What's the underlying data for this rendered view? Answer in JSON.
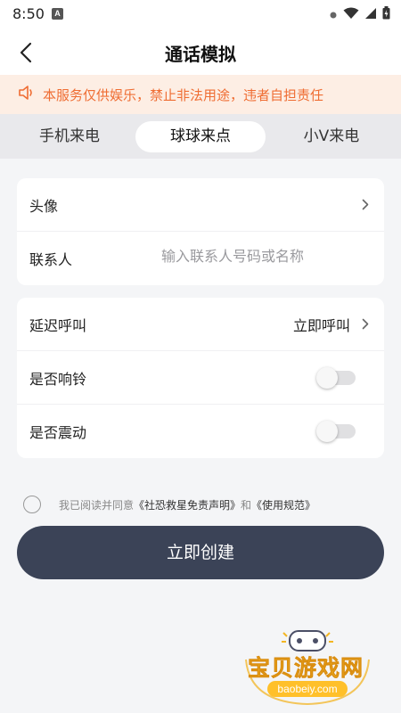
{
  "status_bar": {
    "time": "8:50",
    "indicator": "A",
    "icons": [
      "settings-dot-icon",
      "wifi-icon",
      "signal-icon",
      "battery-icon"
    ]
  },
  "nav": {
    "title": "通话模拟"
  },
  "notice": {
    "text": "本服务仅供娱乐，禁止非法用途，违者自担责任",
    "color": "#ef6d33"
  },
  "tabs": [
    {
      "label": "手机来电",
      "active": false
    },
    {
      "label": "球球来点",
      "active": true
    },
    {
      "label": "小V来电",
      "active": false
    }
  ],
  "form": {
    "avatar_label": "头像",
    "contact_label": "联系人",
    "contact_placeholder": "输入联系人号码或名称",
    "delay_label": "延迟呼叫",
    "delay_value": "立即呼叫",
    "ring_label": "是否响铃",
    "ring_on": false,
    "vibrate_label": "是否震动",
    "vibrate_on": false
  },
  "agreement": {
    "prefix": "我已阅读并同意",
    "link1": "《社恐救星免责声明》",
    "conjunction": "和",
    "link2": "《使用规范》",
    "checked": false
  },
  "create_button": "立即创建",
  "watermark": {
    "text": "宝贝游戏网",
    "url": "baobeiy.com"
  },
  "colors": {
    "primary_button": "#3b4357",
    "background": "#f4f5f7",
    "notice_bg": "#fdeee4"
  }
}
